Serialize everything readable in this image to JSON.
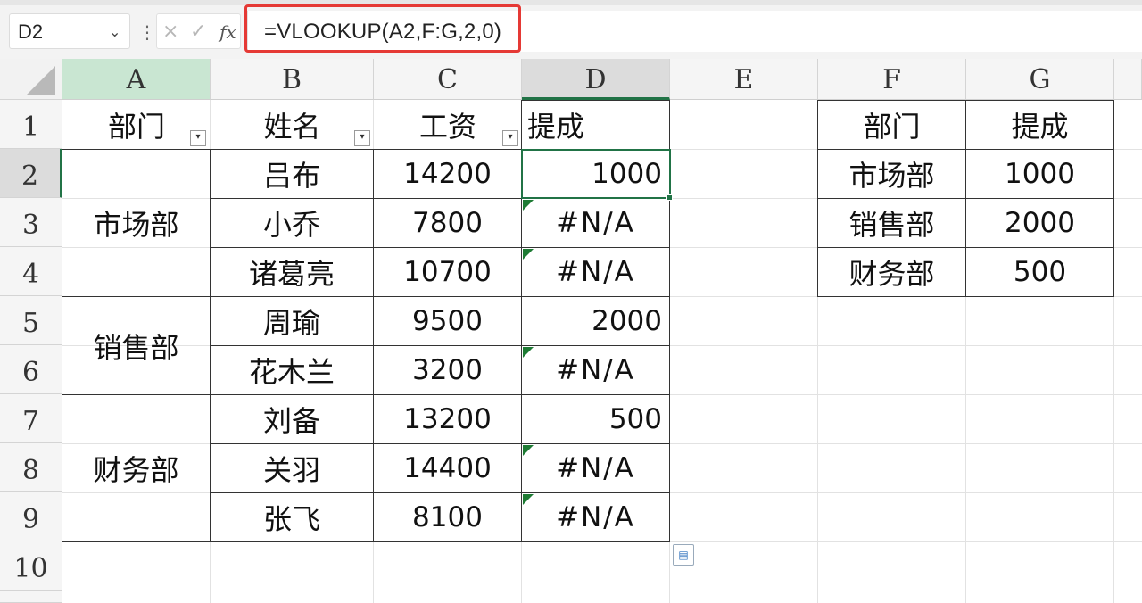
{
  "formula_bar": {
    "name_box": "D2",
    "formula": "=VLOOKUP(A2,F:G,2,0)",
    "fx_label": "fx",
    "cancel_icon": "×",
    "enter_icon": "✓"
  },
  "columns": [
    "A",
    "B",
    "C",
    "D",
    "E",
    "F",
    "G"
  ],
  "rows": [
    "1",
    "2",
    "3",
    "4",
    "5",
    "6",
    "7",
    "8",
    "9",
    "10"
  ],
  "main_table": {
    "headers": [
      "部门",
      "姓名",
      "工资",
      "提成"
    ],
    "departments": [
      "市场部",
      "销售部",
      "财务部"
    ],
    "records": [
      {
        "name": "吕布",
        "salary": "14200",
        "bonus": "1000"
      },
      {
        "name": "小乔",
        "salary": "7800",
        "bonus": "#N/A"
      },
      {
        "name": "诸葛亮",
        "salary": "10700",
        "bonus": "#N/A"
      },
      {
        "name": "周瑜",
        "salary": "9500",
        "bonus": "2000"
      },
      {
        "name": "花木兰",
        "salary": "3200",
        "bonus": "#N/A"
      },
      {
        "name": "刘备",
        "salary": "13200",
        "bonus": "500"
      },
      {
        "name": "关羽",
        "salary": "14400",
        "bonus": "#N/A"
      },
      {
        "name": "张飞",
        "salary": "8100",
        "bonus": "#N/A"
      }
    ]
  },
  "lookup_table": {
    "headers": [
      "部门",
      "提成"
    ],
    "rows": [
      {
        "dept": "市场部",
        "bonus": "1000"
      },
      {
        "dept": "销售部",
        "bonus": "2000"
      },
      {
        "dept": "财务部",
        "bonus": "500"
      }
    ]
  },
  "colors": {
    "selection_green": "#217346",
    "error_triangle": "#1e7b34",
    "formula_highlight": "#e53935"
  }
}
